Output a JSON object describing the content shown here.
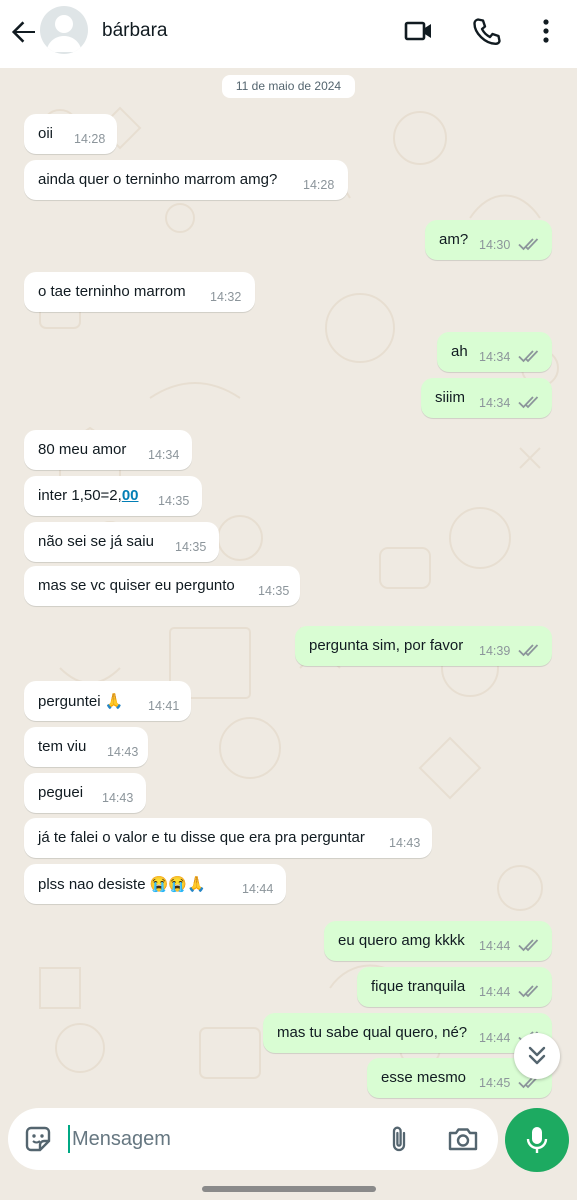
{
  "header": {
    "contact_name": "bárbara",
    "icons": [
      "back-arrow-icon",
      "avatar-placeholder-icon",
      "video-call-icon",
      "phone-icon",
      "more-vert-icon"
    ]
  },
  "chat": {
    "date_chip": "11 de maio de 2024",
    "messages": [
      {
        "dir": "in",
        "text": "oii",
        "time": "14:28"
      },
      {
        "dir": "in",
        "text": "ainda quer o terninho marrom amg?",
        "time": "14:28"
      },
      {
        "dir": "out",
        "text": "am?",
        "time": "14:30",
        "read": true
      },
      {
        "dir": "in",
        "text": "o tae terninho marrom",
        "time": "14:32"
      },
      {
        "dir": "out",
        "text": "ah",
        "time": "14:34",
        "read": true
      },
      {
        "dir": "out",
        "text": "siiim",
        "time": "14:34",
        "read": true
      },
      {
        "dir": "in",
        "text": "80 meu amor",
        "time": "14:34"
      },
      {
        "dir": "in",
        "text_prefix": "inter 1,50=2,",
        "text_link": "00",
        "time": "14:35"
      },
      {
        "dir": "in",
        "text": "não sei se já saiu",
        "time": "14:35"
      },
      {
        "dir": "in",
        "text": "mas se vc quiser eu pergunto",
        "time": "14:35"
      },
      {
        "dir": "out",
        "text": "pergunta sim, por favor",
        "time": "14:39",
        "read": true
      },
      {
        "dir": "in",
        "text": "perguntei 🙏",
        "time": "14:41"
      },
      {
        "dir": "in",
        "text": "tem viu",
        "time": "14:43"
      },
      {
        "dir": "in",
        "text": "peguei",
        "time": "14:43"
      },
      {
        "dir": "in",
        "text": "já te falei o valor e tu disse que era pra perguntar",
        "time": "14:43"
      },
      {
        "dir": "in",
        "text": "plss nao desiste 😭😭🙏",
        "time": "14:44"
      },
      {
        "dir": "out",
        "text": "eu quero amg kkkk",
        "time": "14:44",
        "read": true
      },
      {
        "dir": "out",
        "text": "fique tranquila",
        "time": "14:44",
        "read": true
      },
      {
        "dir": "out",
        "text": "mas tu sabe qual quero, né?",
        "time": "14:44",
        "read": true
      },
      {
        "dir": "out",
        "text": "esse mesmo",
        "time": "14:45",
        "read": true
      }
    ]
  },
  "composer": {
    "placeholder": "Mensagem",
    "icons": [
      "emoji-sticker-icon",
      "attach-icon",
      "camera-icon",
      "mic-icon",
      "chevron-double-down-icon"
    ]
  },
  "colors": {
    "chat_bg": "#efeae2",
    "incoming_bubble": "#ffffff",
    "outgoing_bubble": "#d9fdd3",
    "read_ticks": "#8c959b",
    "mic_button": "#1daa61",
    "link": "#027eb5"
  }
}
